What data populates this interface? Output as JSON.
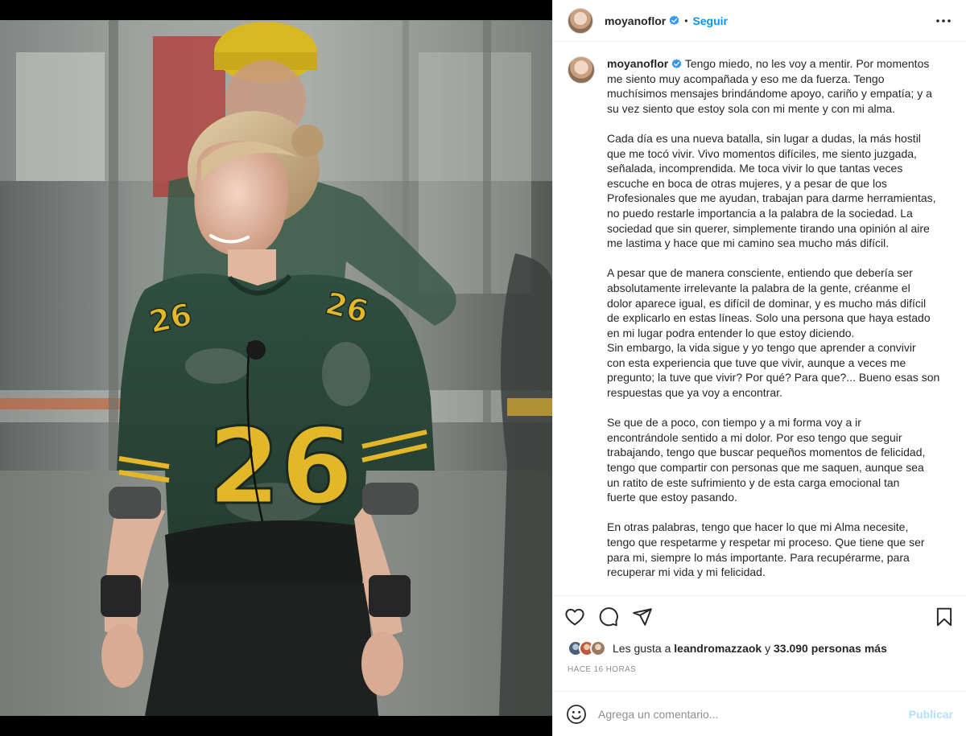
{
  "post": {
    "username": "moyanoflor",
    "separator": "•",
    "follow_label": "Seguir",
    "photo_alt": "",
    "caption": {
      "paragraphs": [
        "Tengo miedo, no les voy a mentir. Por momentos\nme siento muy acompañada y eso me da fuerza. Tengo\nmuchísimos mensajes brindándome apoyo, cariño y empatía; y a\nsu vez siento que estoy sola con mi mente y con mi alma.",
        "Cada día es una nueva batalla, sin lugar a dudas, la más hostil\nque me tocó vivir. Vivo momentos difíciles, me siento juzgada,\nseñalada, incomprendida. Me toca vivir lo que tantas veces\nescuche en boca de otras mujeres, y a pesar de que los\nProfesionales que me ayudan, trabajan para darme herramientas,\nno puedo restarle importancia a la palabra de la sociedad. La\nsociedad que sin querer, simplemente tirando una opinión al aire\nme lastima y hace que mi camino sea mucho más difícil.",
        "A pesar que de manera consciente, entiendo que debería ser\nabsolutamente irrelevante la palabra de la gente, créanme el\ndolor aparece igual, es difícil de dominar, y es mucho más difícil\nde explicarlo en estas líneas. Solo una persona que haya estado\nen mi lugar podra entender lo que estoy diciendo.\nSin embargo, la vida sigue y yo tengo que aprender a convivir\ncon esta experiencia que tuve que vivir, aunque a veces me\npregunto; la tuve que vivir? Por qué? Para que?... Bueno esas son\nrespuestas que ya voy a encontrar.",
        "Se que de a poco, con tiempo y a mi forma voy a ir\nencontrándole sentido a mi dolor. Por eso tengo que seguir\ntrabajando, tengo que buscar pequeños momentos de felicidad,\ntengo que compartir con personas que me saquen, aunque sea\nun ratito de este sufrimiento y de esta carga emocional tan\nfuerte que estoy pasando.",
        "En otras palabras, tengo que hacer lo que mi Alma necesite,\ntengo que respetarme y respetar mi proceso. Que tiene que ser\npara mi, siempre lo más importante. Para recupérarme, para\nrecuperar mi vida y mi felicidad."
      ]
    },
    "likes": {
      "prefix": "Les gusta a",
      "user": "leandromazzaok",
      "connector": "y",
      "count_text": "33.090 personas más"
    },
    "timestamp": "HACE 16 HORAS",
    "comment": {
      "placeholder": "Agrega un comentario...",
      "publish_label": "Publicar"
    }
  },
  "icons": {
    "verified": "verified-badge-icon",
    "more": "more-options-icon",
    "like": "heart-icon",
    "comment": "comment-bubble-icon",
    "share": "paper-plane-icon",
    "save": "bookmark-icon",
    "emoji": "smiley-icon"
  },
  "colors": {
    "accent": "#0095f6",
    "publish_disabled": "#b2dffc",
    "verified": "#3897f0",
    "jersey_green": "#2c4a3a",
    "jersey_number": "#e4b72a"
  }
}
